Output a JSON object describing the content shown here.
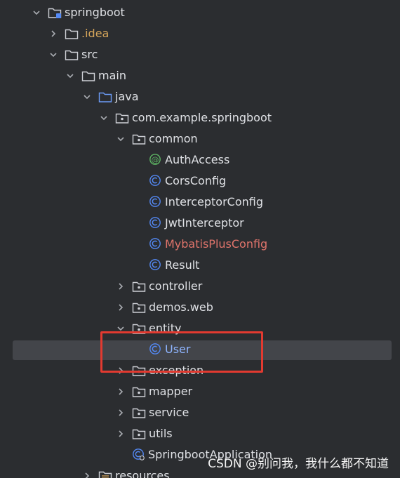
{
  "tree": {
    "nodes": [
      {
        "label": "springboot",
        "icon": "folder-module-icon",
        "chevron": "down"
      },
      {
        "label": ".idea",
        "icon": "folder-icon",
        "chevron": "right",
        "color": "#d5a55a"
      },
      {
        "label": "src",
        "icon": "folder-icon",
        "chevron": "down"
      },
      {
        "label": "main",
        "icon": "folder-icon",
        "chevron": "down"
      },
      {
        "label": "java",
        "icon": "folder-source-icon",
        "chevron": "down"
      },
      {
        "label": "com.example.springboot",
        "icon": "package-icon",
        "chevron": "down"
      },
      {
        "label": "common",
        "icon": "package-icon",
        "chevron": "down"
      },
      {
        "label": "AuthAccess",
        "icon": "annotation-icon"
      },
      {
        "label": "CorsConfig",
        "icon": "class-icon"
      },
      {
        "label": "InterceptorConfig",
        "icon": "class-icon"
      },
      {
        "label": "JwtInterceptor",
        "icon": "class-icon"
      },
      {
        "label": "MybatisPlusConfig",
        "icon": "class-icon",
        "color": "#e0746b"
      },
      {
        "label": "Result",
        "icon": "class-icon"
      },
      {
        "label": "controller",
        "icon": "package-icon",
        "chevron": "right"
      },
      {
        "label": "demos.web",
        "icon": "package-icon",
        "chevron": "right"
      },
      {
        "label": "entity",
        "icon": "package-icon",
        "chevron": "down"
      },
      {
        "label": "User",
        "icon": "class-icon",
        "selected": true,
        "color": "#8fb5ff"
      },
      {
        "label": "exception",
        "icon": "package-icon",
        "chevron": "right"
      },
      {
        "label": "mapper",
        "icon": "package-icon",
        "chevron": "right"
      },
      {
        "label": "service",
        "icon": "package-icon",
        "chevron": "right"
      },
      {
        "label": "utils",
        "icon": "package-icon",
        "chevron": "right"
      },
      {
        "label": "SpringbootApplication",
        "icon": "spring-boot-class-icon"
      },
      {
        "label": "resources",
        "icon": "folder-resources-icon",
        "chevron": "right"
      }
    ]
  },
  "watermark": "CSDN @别问我，我什么都不知道",
  "colors": {
    "background": "#2b2d30",
    "selection": "#43454a",
    "highlight_box": "#e23a30",
    "class_icon": "#548af7",
    "annotation_icon": "#5fb865"
  }
}
